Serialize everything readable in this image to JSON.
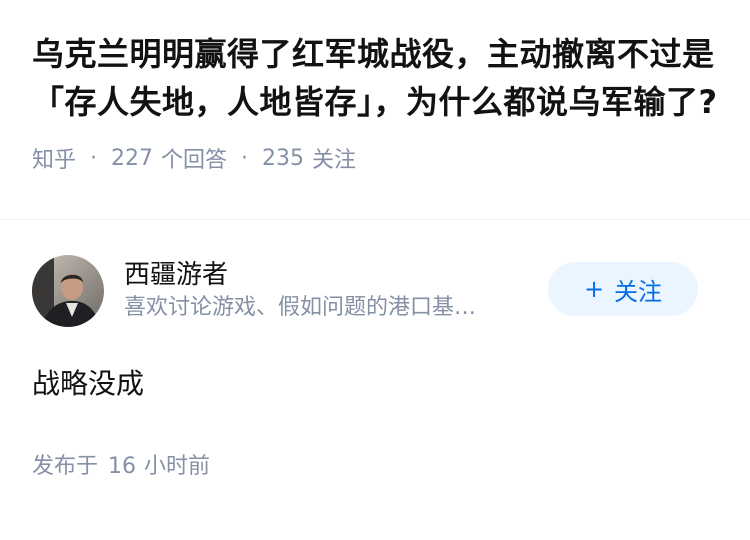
{
  "question": {
    "title": "乌克兰明明赢得了红军城战役，主动撤离不过是「存人失地，人地皆存」，为什么都说乌军输了?",
    "source": "知乎",
    "separator": "·",
    "answer_count": "227",
    "answer_count_label": "个回答",
    "follower_count": "235",
    "follower_count_label": "关注"
  },
  "answer": {
    "author": {
      "name": "西疆游者",
      "bio": "喜欢讨论游戏、假如问题的港口基…",
      "avatar_icon": "person-avatar"
    },
    "follow_button": {
      "plus": "+",
      "label": "关注"
    },
    "content": "战略没成",
    "time": {
      "prefix": "发布于",
      "value": "16",
      "unit": "小时前"
    }
  },
  "colors": {
    "meta_gray": "#8590a6",
    "accent_blue": "#056de8",
    "follow_bg": "#ebf5ff",
    "text": "#121212"
  }
}
